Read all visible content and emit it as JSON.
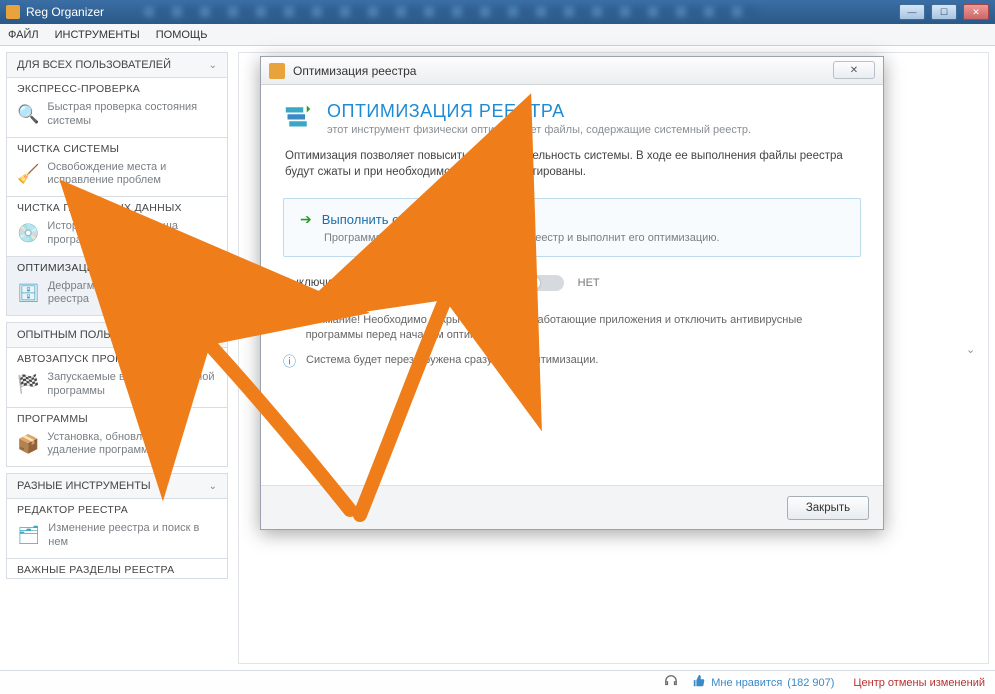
{
  "window": {
    "app_title": "Reg Organizer",
    "controls": {
      "min": "—",
      "max": "☐",
      "close": "✕"
    }
  },
  "menubar": {
    "items": [
      "ФАЙЛ",
      "ИНСТРУМЕНТЫ",
      "ПОМОЩЬ"
    ]
  },
  "sidebar": {
    "section_all_users": "ДЛЯ ВСЕХ ПОЛЬЗОВАТЕЛЕЙ",
    "items_all": [
      {
        "title": "ЭКСПРЕСС-ПРОВЕРКА",
        "desc": "Быстрая проверка состояния системы",
        "icon": "🔍"
      },
      {
        "title": "ЧИСТКА СИСТЕМЫ",
        "desc": "Освобождение места и исправление проблем",
        "icon": "🧹"
      },
      {
        "title": "ЧИСТКА ПРИВАТНЫХ ДАННЫХ",
        "desc": "Истории браузеров, кэша программ и др.",
        "icon": "💿"
      },
      {
        "title": "ОПТИМИЗАЦИЯ РЕЕСТРА",
        "desc": "Дефрагментация и сжатие реестра",
        "icon": "🗄"
      }
    ],
    "section_advanced": "ОПЫТНЫМ ПОЛЬЗОВАТЕЛЯМ",
    "items_adv": [
      {
        "title": "АВТОЗАПУСК ПРОГРАММ",
        "desc": "Запускаемые вместе с системой программы",
        "icon": "🏁"
      },
      {
        "title": "ПРОГРАММЫ",
        "desc": "Установка, обновление и удаление программ.",
        "icon": "📦"
      }
    ],
    "section_tools": "РАЗНЫЕ ИНСТРУМЕНТЫ",
    "items_tools": [
      {
        "title": "РЕДАКТОР РЕЕСТРА",
        "desc": "Изменение реестра и поиск в нем",
        "icon": "🗂"
      },
      {
        "title": "ВАЖНЫЕ РАЗДЕЛЫ РЕЕСТРА",
        "desc": "",
        "icon": ""
      }
    ]
  },
  "dialog": {
    "title": "Оптимизация реестра",
    "heading": "ОПТИМИЗАЦИЯ РЕЕСТРА",
    "subheading": "этот инструмент физически оптимизирует файлы, содержащие системный реестр.",
    "paragraph": "Оптимизация позволяет повысить производительность системы. В ходе ее выполнения файлы реестра будут сжаты и при необходимости дефрагментированы.",
    "action_title": "Выполнить оптимизацию реестра",
    "action_desc": "Программа проанализирует системный реестр и выполнит его оптимизацию.",
    "shutdown_label": "Выключить компьютер после оптимизации",
    "shutdown_value": "НЕТ",
    "warning": "Внимание! Необходимо закрыть все другие работающие приложения и отключить антивирусные программы перед началом оптимизации.",
    "info": "Система будет перезагружена сразу после оптимизации.",
    "close_btn": "Закрыть",
    "titlebar_close": "✕"
  },
  "statusbar": {
    "like_label": "Мне нравится",
    "like_count": "(182 907)",
    "undo_label": "Центр отмены изменений"
  }
}
